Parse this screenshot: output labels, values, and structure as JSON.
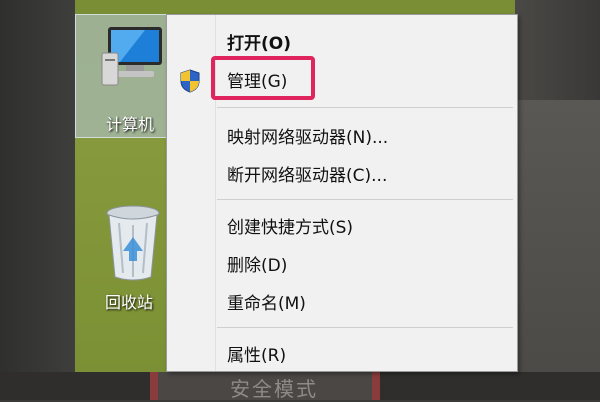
{
  "desktop": {
    "computer_label": "计算机",
    "recycle_label": "回收站"
  },
  "menu": {
    "open": "打开(O)",
    "manage": "管理(G)",
    "map_drive": "映射网络驱动器(N)...",
    "disconnect_drive": "断开网络驱动器(C)...",
    "create_shortcut": "创建快捷方式(S)",
    "delete": "删除(D)",
    "rename": "重命名(M)",
    "properties": "属性(R)"
  },
  "background": {
    "bottom_text": "安全模式"
  },
  "colors": {
    "desktop": "#86993c",
    "highlight": "#e0245e",
    "menu_bg": "#f1f1f1"
  }
}
